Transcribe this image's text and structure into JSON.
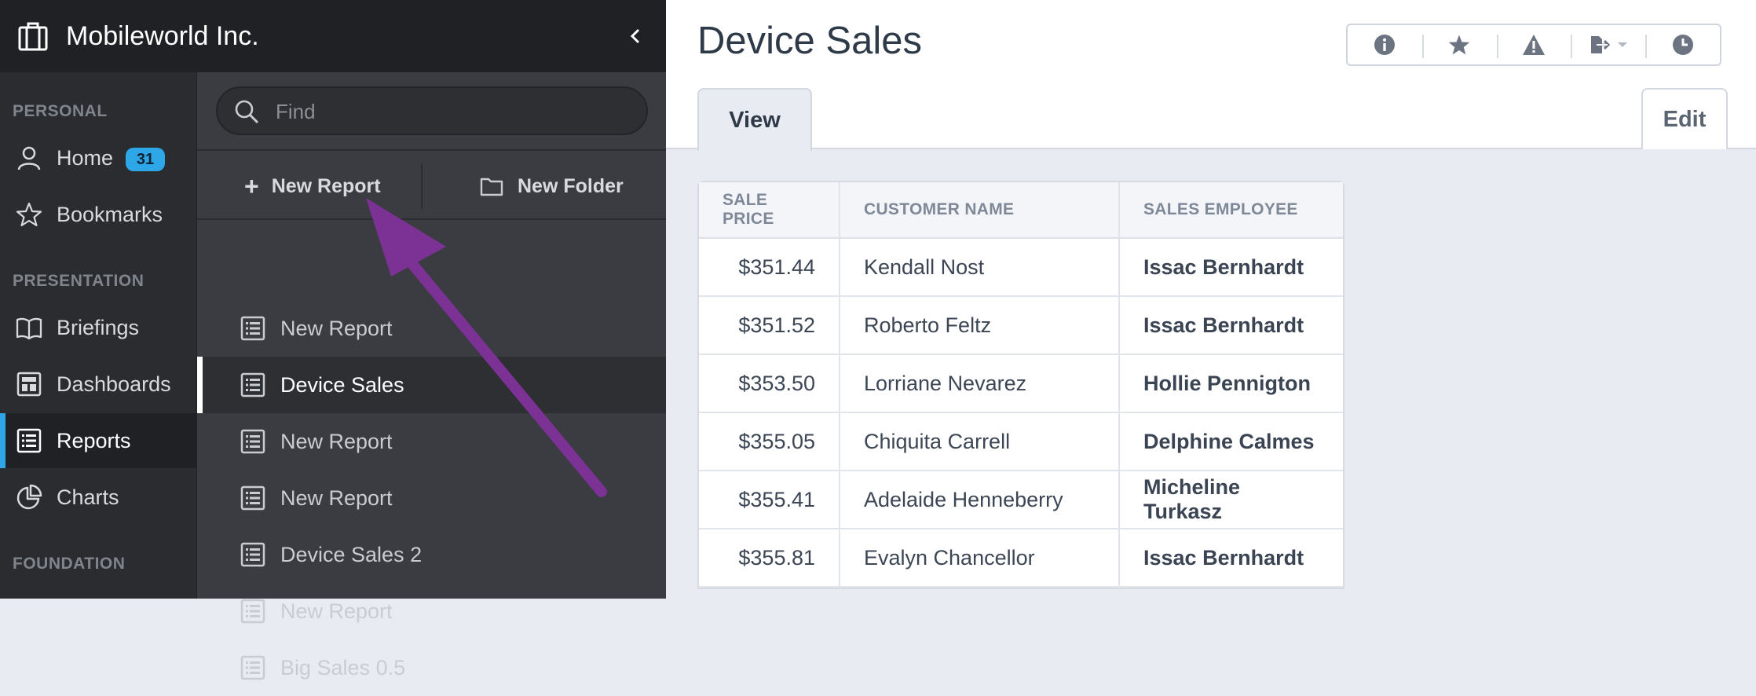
{
  "org": {
    "name": "Mobileworld Inc."
  },
  "nav": {
    "sections": {
      "personal": "PERSONAL",
      "presentation": "PRESENTATION",
      "foundation": "FOUNDATION"
    },
    "items": [
      {
        "label": "Home",
        "icon": "user-icon",
        "badge": "31"
      },
      {
        "label": "Bookmarks",
        "icon": "star-outline-icon"
      },
      {
        "label": "Briefings",
        "icon": "book-icon"
      },
      {
        "label": "Dashboards",
        "icon": "dashboard-icon"
      },
      {
        "label": "Reports",
        "icon": "report-list-icon",
        "active": true
      },
      {
        "label": "Charts",
        "icon": "pie-chart-icon"
      }
    ]
  },
  "explorer": {
    "search_placeholder": "Find",
    "new_report_label": "New Report",
    "new_folder_label": "New Folder",
    "reports": [
      "New Report",
      "Device Sales",
      "New Report",
      "New Report",
      "Device Sales 2",
      "New Report",
      "Big Sales 0.5"
    ],
    "active_index": 1
  },
  "main": {
    "title": "Device Sales",
    "toolbar": [
      "info-icon",
      "star-icon",
      "warning-icon",
      "export-icon",
      "clock-icon"
    ],
    "tabs": {
      "view": "View",
      "edit": "Edit"
    },
    "table": {
      "headers": [
        "SALE PRICE",
        "CUSTOMER NAME",
        "SALES EMPLOYEE"
      ],
      "rows": [
        [
          "$351.44",
          "Kendall Nost",
          "Issac Bernhardt"
        ],
        [
          "$351.52",
          "Roberto Feltz",
          "Issac Bernhardt"
        ],
        [
          "$353.50",
          "Lorriane Nevarez",
          "Hollie Pennigton"
        ],
        [
          "$355.05",
          "Chiquita Carrell",
          "Delphine Calmes"
        ],
        [
          "$355.41",
          "Adelaide Henneberry",
          "Micheline Turkasz"
        ],
        [
          "$355.81",
          "Evalyn Chancellor",
          "Issac Bernhardt"
        ]
      ]
    }
  },
  "annotation": {
    "color": "#7b3294",
    "target": "new-report-button"
  },
  "colors": {
    "accent": "#2ea7e8",
    "sidebar_dark": "#1f2124",
    "explorer_bg": "#3a3c41"
  }
}
